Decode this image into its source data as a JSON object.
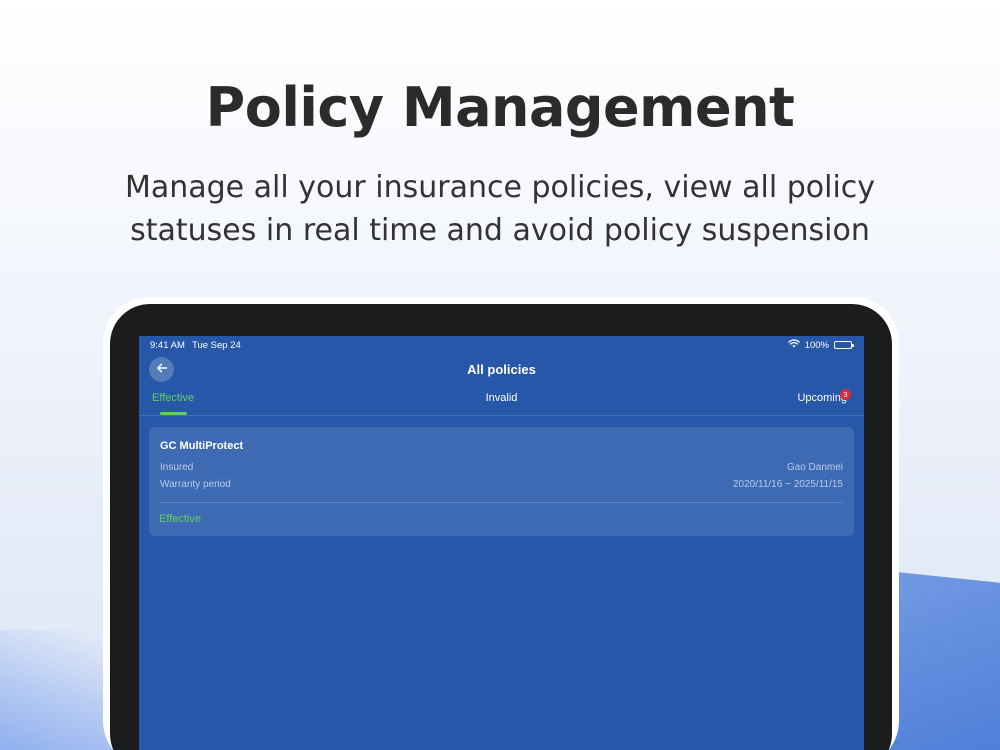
{
  "headline": "Policy Management",
  "subline": {
    "line1": "Manage all your insurance policies, view all policy",
    "line2": "statuses in real time and avoid policy suspension"
  },
  "statusbar": {
    "time": "9:41 AM",
    "date": "Tue Sep 24",
    "battery": "100%",
    "icons": [
      "wifi-icon",
      "battery-icon"
    ]
  },
  "navbar": {
    "title": "All policies",
    "back_icon": "arrow-left-icon"
  },
  "tabs": [
    {
      "label": "Effective",
      "active": true
    },
    {
      "label": "Invalid",
      "active": false
    },
    {
      "label": "Upcoming",
      "active": false,
      "badge": "3"
    }
  ],
  "policy": {
    "name": "GC MultiProtect",
    "insured_label": "Insured",
    "insured_value": "Gao Danmei",
    "period_label": "Warranty period",
    "period_value": "2020/11/16 ~ 2025/11/15",
    "status": "Effective"
  },
  "colors": {
    "screen_bg": "#2757a8",
    "card_bg": "#3e6ab4",
    "accent_green": "#5fd15f",
    "badge_red": "#e02a3c"
  }
}
